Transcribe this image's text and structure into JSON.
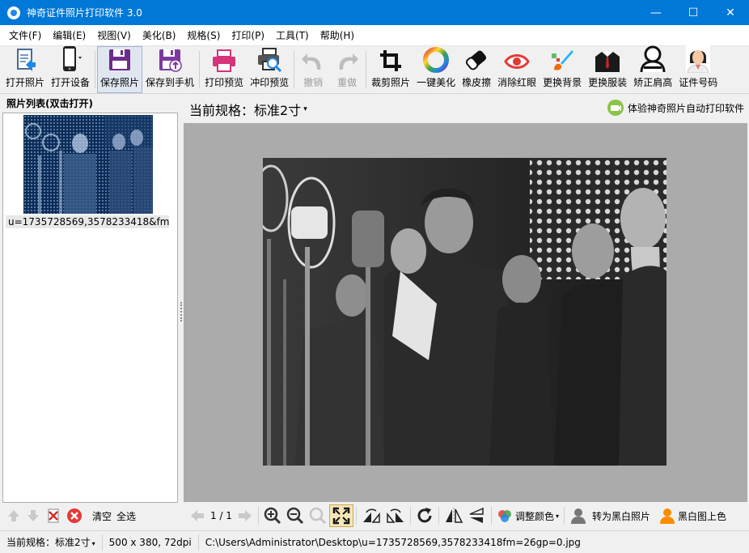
{
  "window": {
    "title": "神奇证件照片打印软件 3.0",
    "minimize": "—",
    "maximize": "☐",
    "close": "✕"
  },
  "menu": [
    "文件(F)",
    "编辑(E)",
    "视图(V)",
    "美化(B)",
    "规格(S)",
    "打印(P)",
    "工具(T)",
    "帮助(H)"
  ],
  "toolbar": {
    "open_photo": "打开照片",
    "open_device": "打开设备",
    "save_photo": "保存照片",
    "save_to_phone": "保存到手机",
    "print_preview": "打印预览",
    "develop_preview": "冲印预览",
    "undo": "撤销",
    "redo": "重做",
    "crop": "裁剪照片",
    "beautify": "一键美化",
    "eraser": "橡皮擦",
    "red_eye": "消除红眼",
    "change_bg": "更换背景",
    "change_clothes": "更换服装",
    "shoulder": "矫正肩高",
    "id_number": "证件号码"
  },
  "left_panel": {
    "header": "照片列表(双击打开)",
    "thumb_caption": "u=1735728569,3578233418&fm...",
    "clear": "清空",
    "select_all": "全选"
  },
  "main": {
    "spec_label": "当前规格：标准2寸",
    "spec_caret": "▾",
    "auto_print_link": "体验神奇照片自动打印软件"
  },
  "bottom_tools": {
    "page": "1 / 1",
    "adjust_color": "调整颜色",
    "to_bw": "转为黑白照片",
    "bw_colorize": "黑白图上色"
  },
  "status": {
    "spec": "当前规格：",
    "spec_value": "标准2寸",
    "size": "500 x 380, 72dpi",
    "path": "C:\\Users\\Administrator\\Desktop\\u=1735728569,3578233418fm=26gp=0.jpg"
  }
}
